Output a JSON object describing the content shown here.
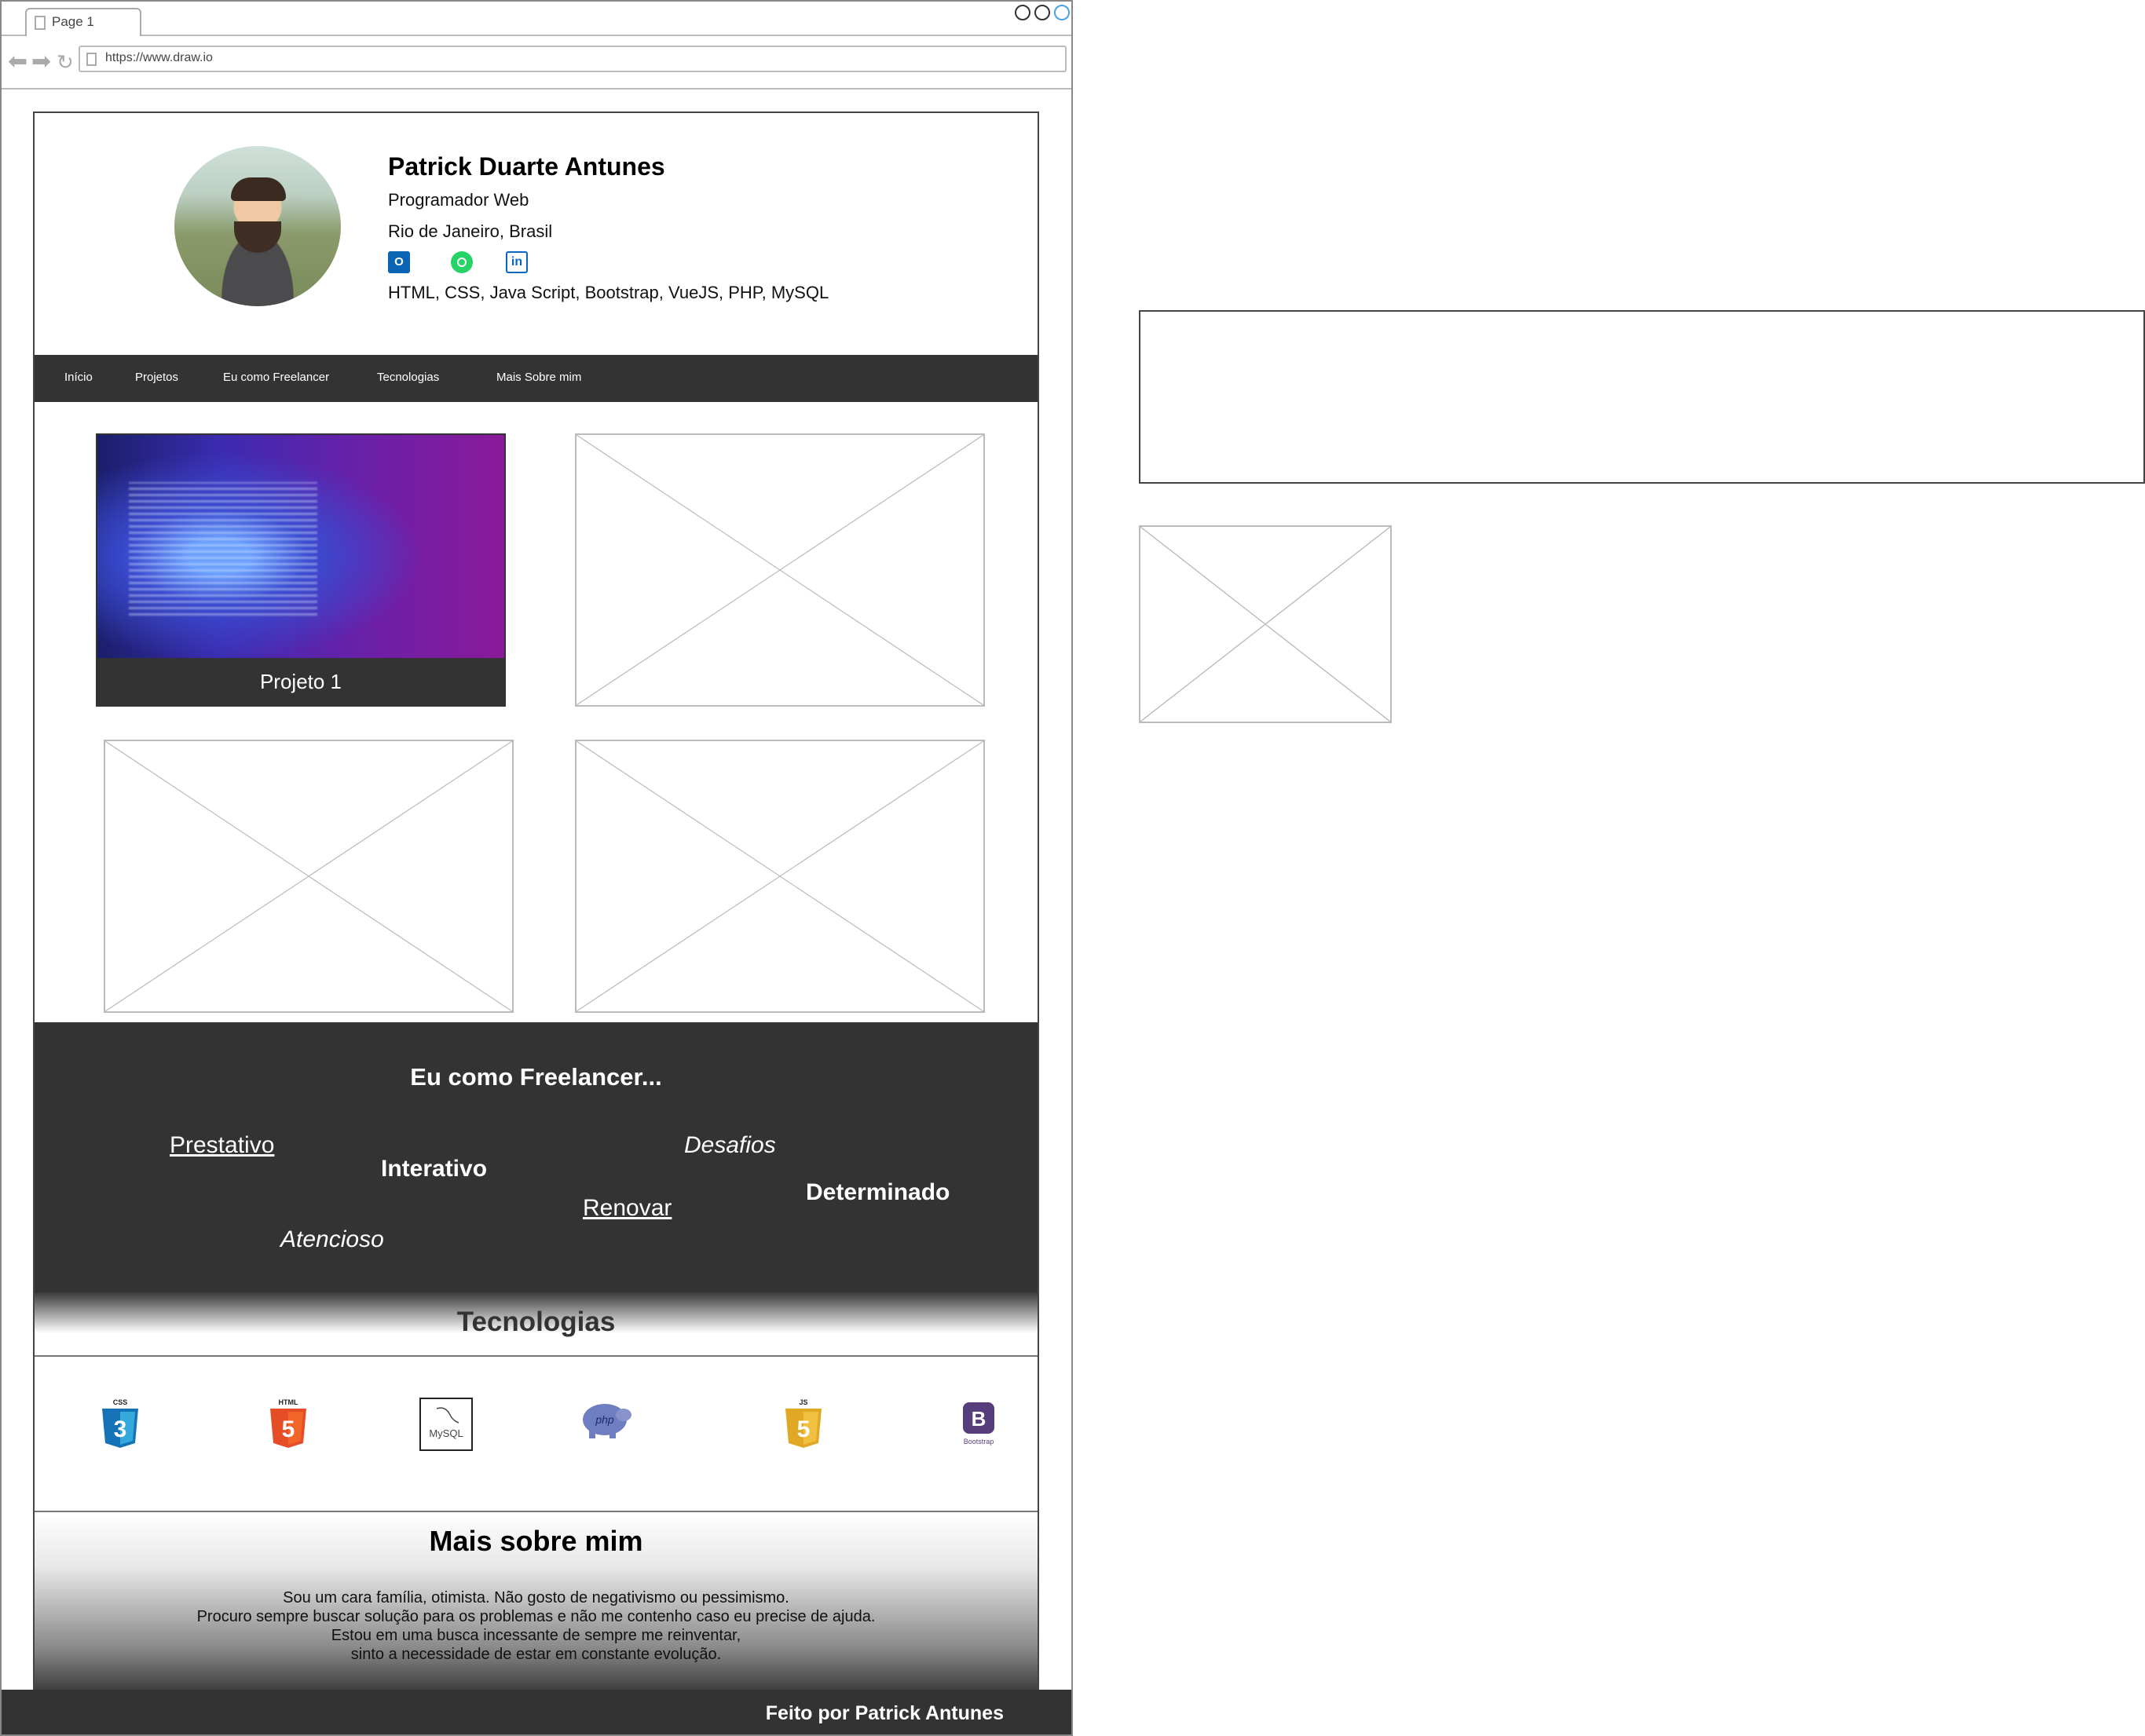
{
  "browser": {
    "tab_label": "Page 1",
    "url": "https://www.draw.io"
  },
  "profile": {
    "name": "Patrick Duarte Antunes",
    "role": "Programador Web",
    "location": "Rio de Janeiro, Brasil",
    "skills": "HTML, CSS, Java Script, Bootstrap, VueJS, PHP, MySQL",
    "social_icons": [
      "outlook-icon",
      "whatsapp-icon",
      "linkedin-icon"
    ]
  },
  "nav": {
    "items": [
      "Início",
      "Projetos",
      "Eu como Freelancer",
      "Tecnologias",
      "Mais Sobre mim"
    ]
  },
  "projects": {
    "items": [
      {
        "caption": "Projeto 1"
      },
      {
        "caption": ""
      },
      {
        "caption": ""
      },
      {
        "caption": ""
      }
    ]
  },
  "freelancer": {
    "title": "Eu como Freelancer...",
    "words": [
      "Prestativo",
      "Interativo",
      "Desafios",
      "Determinado",
      "Renovar",
      "Atencioso"
    ]
  },
  "tecnologias": {
    "title": "Tecnologias",
    "icons": [
      {
        "name": "css3-icon",
        "label": "CSS",
        "digit": "3",
        "color": "#1572b6"
      },
      {
        "name": "html5-icon",
        "label": "HTML",
        "digit": "5",
        "color": "#e44d26"
      },
      {
        "name": "mysql-icon",
        "label": "MySQL",
        "color": "#222222"
      },
      {
        "name": "php-icon",
        "label": "php",
        "color": "#6f7ec0"
      },
      {
        "name": "javascript-icon",
        "label": "JS",
        "digit": "5",
        "color": "#e0a824"
      },
      {
        "name": "bootstrap-icon",
        "label": "B",
        "sublabel": "Bootstrap",
        "color": "#563d7c"
      }
    ]
  },
  "sobre": {
    "title": "Mais sobre mim",
    "lines": [
      "Sou um cara família, otimista. Não gosto de negativismo ou pessimismo.",
      "Procuro sempre buscar solução para os problemas e não me contenho caso eu precise de ajuda.",
      "Estou em uma busca incessante de sempre me reinventar,",
      "sinto a necessidade de estar em constante evolução."
    ]
  },
  "footer": {
    "text": "Feito por Patrick Antunes"
  }
}
